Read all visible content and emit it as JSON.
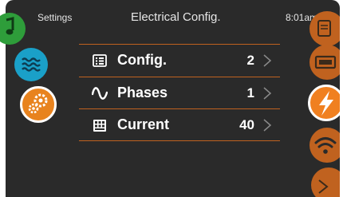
{
  "header": {
    "left_label": "Settings",
    "title": "Electrical Config.",
    "clock": "8:01am"
  },
  "menu": {
    "items": [
      {
        "icon": "config-list-icon",
        "label": "Config.",
        "value": "2"
      },
      {
        "icon": "sine-wave-icon",
        "label": "Phases",
        "value": "1"
      },
      {
        "icon": "current-meter-icon",
        "label": "Current",
        "value": "40"
      }
    ]
  },
  "left_nav": {
    "items": [
      {
        "icon": "music-note-icon",
        "color": "#2e9d3a",
        "selected": false
      },
      {
        "icon": "water-waves-icon",
        "color": "#1aa0c8",
        "selected": false
      },
      {
        "icon": "gears-icon",
        "color": "#e8831e",
        "selected": true
      }
    ]
  },
  "right_nav": {
    "items": [
      {
        "icon": "document-icon",
        "color": "#c0621f",
        "selected": false
      },
      {
        "icon": "device-icon",
        "color": "#c0621f",
        "selected": false
      },
      {
        "icon": "lightning-icon",
        "color": "#f08020",
        "selected": true
      },
      {
        "icon": "wifi-icon",
        "color": "#c0621f",
        "selected": false
      },
      {
        "icon": "partial-icon",
        "color": "#c0621f",
        "selected": false
      }
    ]
  },
  "colors": {
    "background": "#2a2a2a",
    "accent": "#c0621f",
    "text": "#ffffff"
  }
}
